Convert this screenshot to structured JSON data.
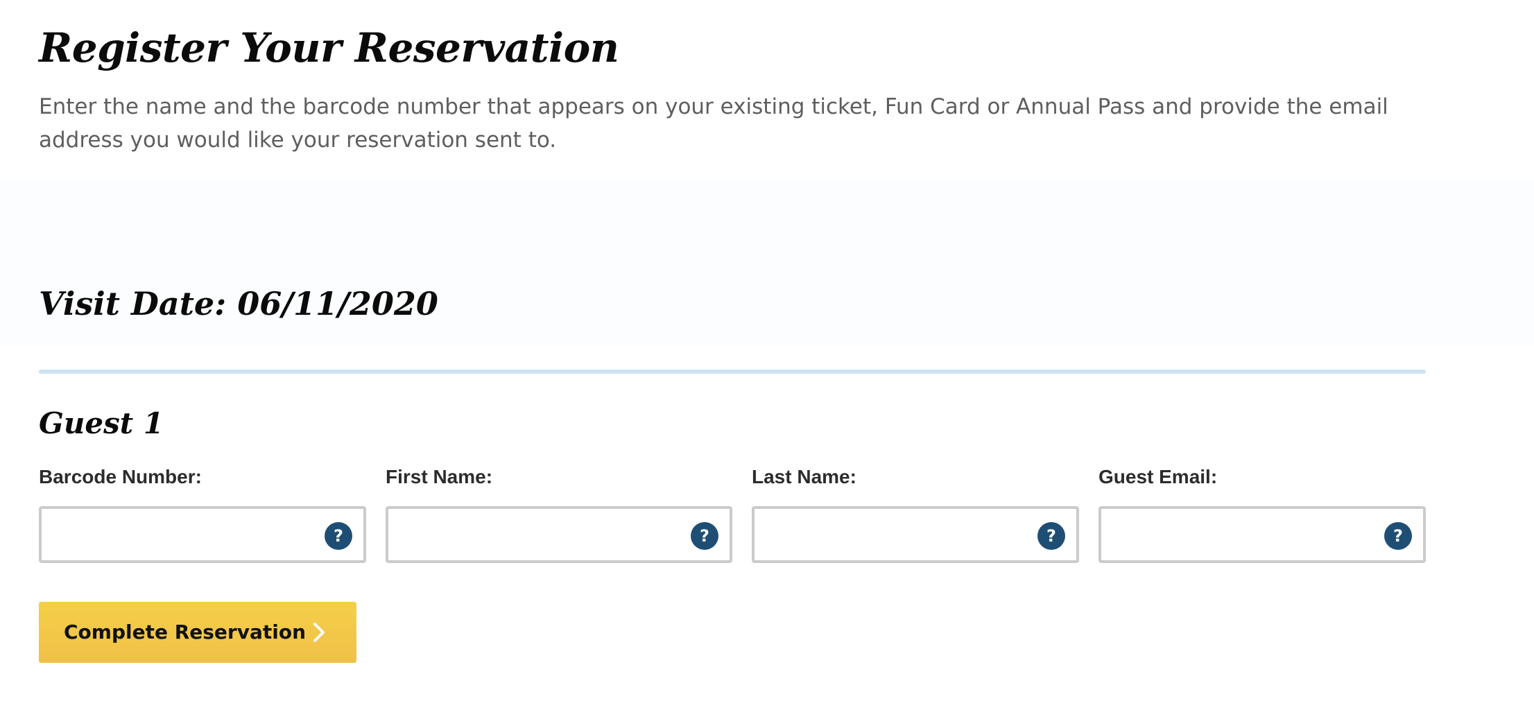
{
  "page": {
    "title": "Register Your Reservation",
    "intro": "Enter the name and the barcode number that appears on your existing ticket, Fun Card or Annual Pass and provide the email address you would like your reservation sent to."
  },
  "visit": {
    "label": "Visit Date: 06/11/2020"
  },
  "guest": {
    "title": "Guest 1",
    "fields": [
      {
        "label": "Barcode Number:",
        "value": "",
        "help_icon": "?"
      },
      {
        "label": "First Name:",
        "value": "",
        "help_icon": "?"
      },
      {
        "label": "Last Name:",
        "value": "",
        "help_icon": "?"
      },
      {
        "label": "Guest Email:",
        "value": "",
        "help_icon": "?"
      }
    ]
  },
  "actions": {
    "submit_label": "Complete Reservation",
    "submit_icon": "chevron-right-icon"
  },
  "colors": {
    "button": "#f5cf49",
    "help_icon": "#1f4e75",
    "divider": "#cde3f1",
    "field_border": "#cbcbcb"
  }
}
